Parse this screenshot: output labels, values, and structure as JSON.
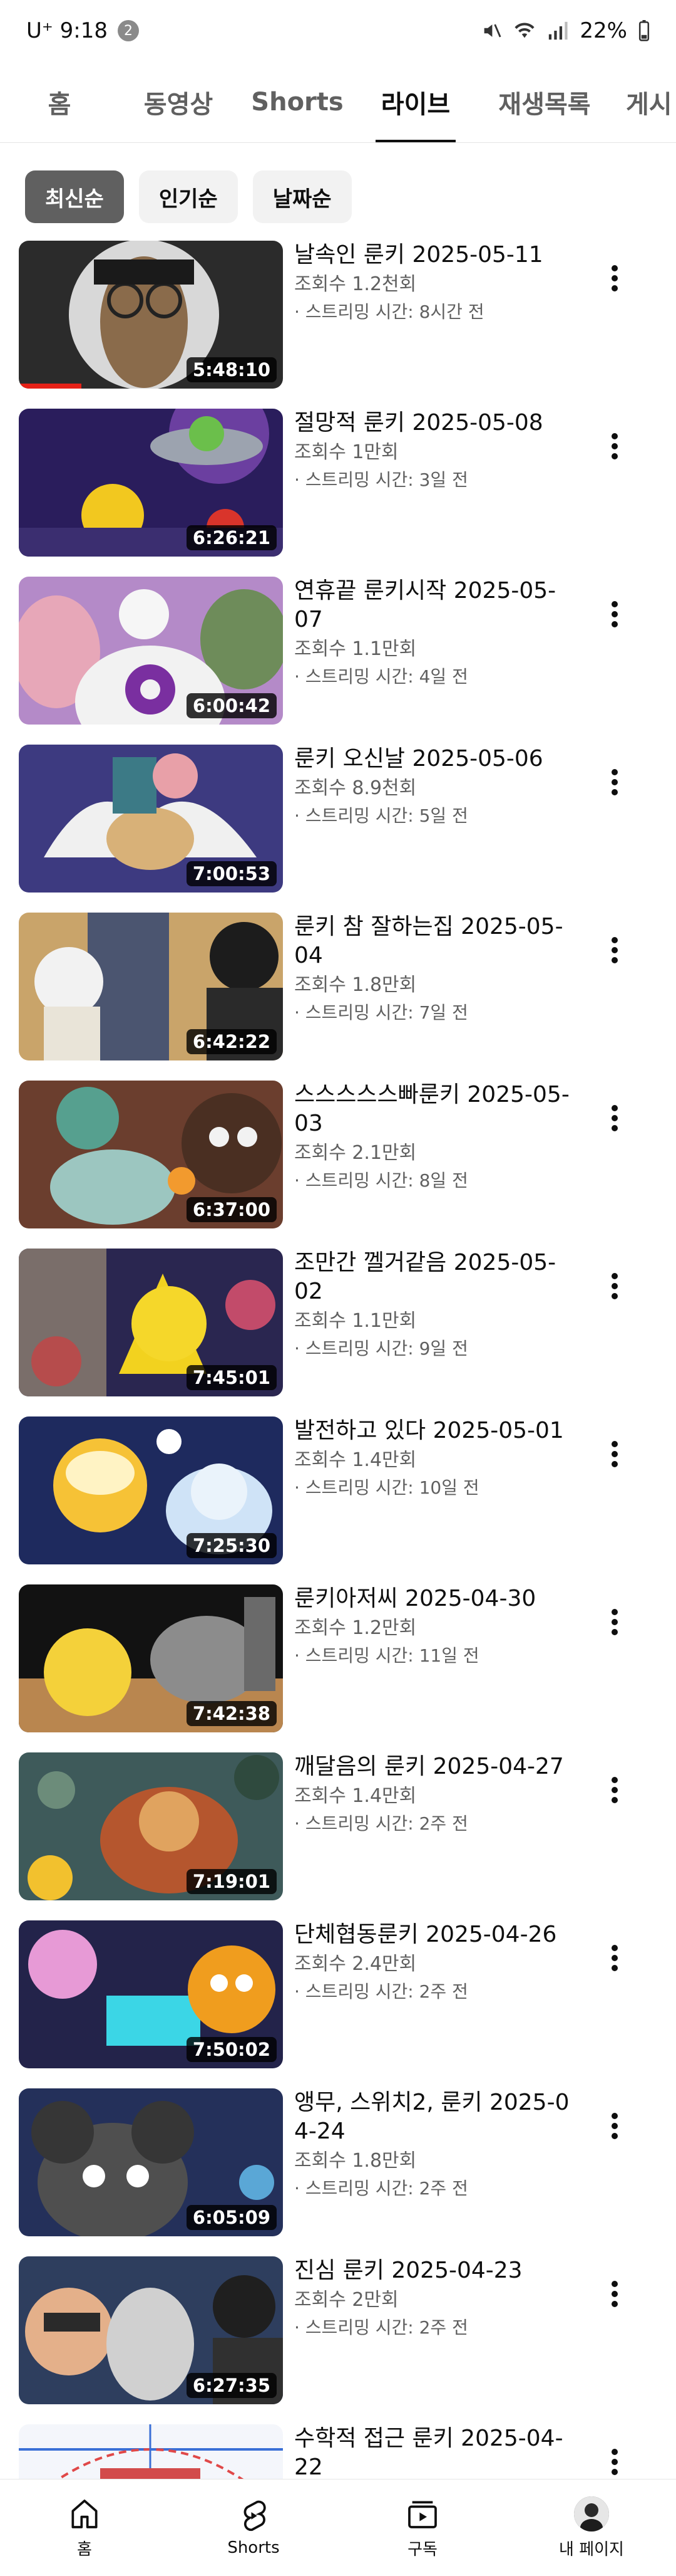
{
  "status_bar": {
    "carrier": "U⁺ 9:18",
    "badge": "2",
    "battery": "22%",
    "icons": [
      "mute-icon",
      "wifi-icon",
      "signal-icon"
    ]
  },
  "tabs": [
    {
      "label": "홈",
      "active": false
    },
    {
      "label": "동영상",
      "active": false
    },
    {
      "label": "Shorts",
      "active": false
    },
    {
      "label": "라이브",
      "active": true
    },
    {
      "label": "재생목록",
      "active": false
    },
    {
      "label": "게시",
      "active": false
    }
  ],
  "chips": [
    {
      "label": "최신순",
      "selected": true
    },
    {
      "label": "인기순",
      "selected": false
    },
    {
      "label": "날짜순",
      "selected": false
    }
  ],
  "videos": [
    {
      "title": "날속인 룬키 2025-05-11",
      "views": "조회수 1.2천회",
      "streamed": "· 스트리밍 시간: 8시간 전",
      "duration": "5:48:10"
    },
    {
      "title": "절망적 룬키 2025-05-08",
      "views": "조회수 1만회",
      "streamed": "· 스트리밍 시간: 3일 전",
      "duration": "6:26:21"
    },
    {
      "title": "연휴끝 룬키시작 2025-05-07",
      "views": "조회수 1.1만회",
      "streamed": "· 스트리밍 시간: 4일 전",
      "duration": "6:00:42"
    },
    {
      "title": "룬키 오신날 2025-05-06",
      "views": "조회수 8.9천회",
      "streamed": "· 스트리밍 시간: 5일 전",
      "duration": "7:00:53"
    },
    {
      "title": "룬키 참 잘하는집 2025-05-04",
      "views": "조회수 1.8만회",
      "streamed": "· 스트리밍 시간: 7일 전",
      "duration": "6:42:22"
    },
    {
      "title": "스스스스스빠룬키 2025-05-03",
      "views": "조회수 2.1만회",
      "streamed": "· 스트리밍 시간: 8일 전",
      "duration": "6:37:00"
    },
    {
      "title": "조만간 껠거같음 2025-05-02",
      "views": "조회수 1.1만회",
      "streamed": "· 스트리밍 시간: 9일 전",
      "duration": "7:45:01"
    },
    {
      "title": "발전하고 있다 2025-05-01",
      "views": "조회수 1.4만회",
      "streamed": "· 스트리밍 시간: 10일 전",
      "duration": "7:25:30"
    },
    {
      "title": "룬키아저씨 2025-04-30",
      "views": "조회수 1.2만회",
      "streamed": "· 스트리밍 시간: 11일 전",
      "duration": "7:42:38"
    },
    {
      "title": "깨달음의 룬키 2025-04-27",
      "views": "조회수 1.4만회",
      "streamed": "· 스트리밍 시간: 2주 전",
      "duration": "7:19:01"
    },
    {
      "title": "단체협동룬키 2025-04-26",
      "views": "조회수 2.4만회",
      "streamed": "· 스트리밍 시간: 2주 전",
      "duration": "7:50:02"
    },
    {
      "title": "앵무, 스위치2, 룬키 2025-04-24",
      "views": "조회수 1.8만회",
      "streamed": "· 스트리밍 시간: 2주 전",
      "duration": "6:05:09"
    },
    {
      "title": "진심 룬키 2025-04-23",
      "views": "조회수 2만회",
      "streamed": "· 스트리밍 시간: 2주 전",
      "duration": "6:27:35"
    },
    {
      "title": "수학적 접근 룬키 2025-04-22",
      "views": "",
      "streamed": "",
      "duration": ""
    }
  ],
  "bottom_nav": [
    {
      "label": "홈",
      "icon": "home-icon"
    },
    {
      "label": "Shorts",
      "icon": "shorts-icon"
    },
    {
      "label": "구독",
      "icon": "subscriptions-icon"
    },
    {
      "label": "내 페이지",
      "icon": "avatar"
    }
  ],
  "colors": {
    "text_primary": "#0f0f0f",
    "text_secondary": "#606060",
    "chip_selected_bg": "#606060",
    "chip_bg": "#f2f2f2"
  }
}
